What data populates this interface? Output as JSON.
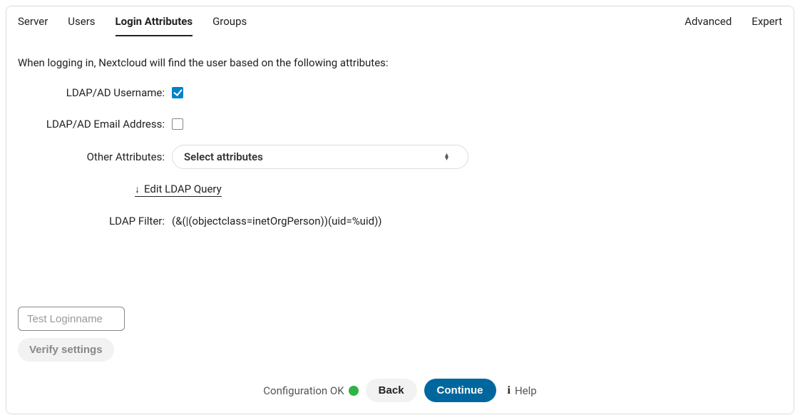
{
  "tabs": {
    "left": [
      "Server",
      "Users",
      "Login Attributes",
      "Groups"
    ],
    "right": [
      "Advanced",
      "Expert"
    ],
    "active": "Login Attributes"
  },
  "intro": "When logging in, Nextcloud will find the user based on the following attributes:",
  "rows": {
    "username_label": "LDAP/AD Username:",
    "username_checked": true,
    "email_label": "LDAP/AD Email Address:",
    "email_checked": false,
    "other_label": "Other Attributes:",
    "other_select_text": "Select attributes",
    "edit_query_label": "Edit LDAP Query",
    "filter_label": "LDAP Filter:",
    "filter_value": "(&(|(objectclass=inetOrgPerson))(uid=%uid))"
  },
  "test": {
    "placeholder": "Test Loginname",
    "verify_label": "Verify settings"
  },
  "footer": {
    "status_text": "Configuration OK",
    "status_color": "#2fb344",
    "back": "Back",
    "continue": "Continue",
    "help": "Help"
  }
}
